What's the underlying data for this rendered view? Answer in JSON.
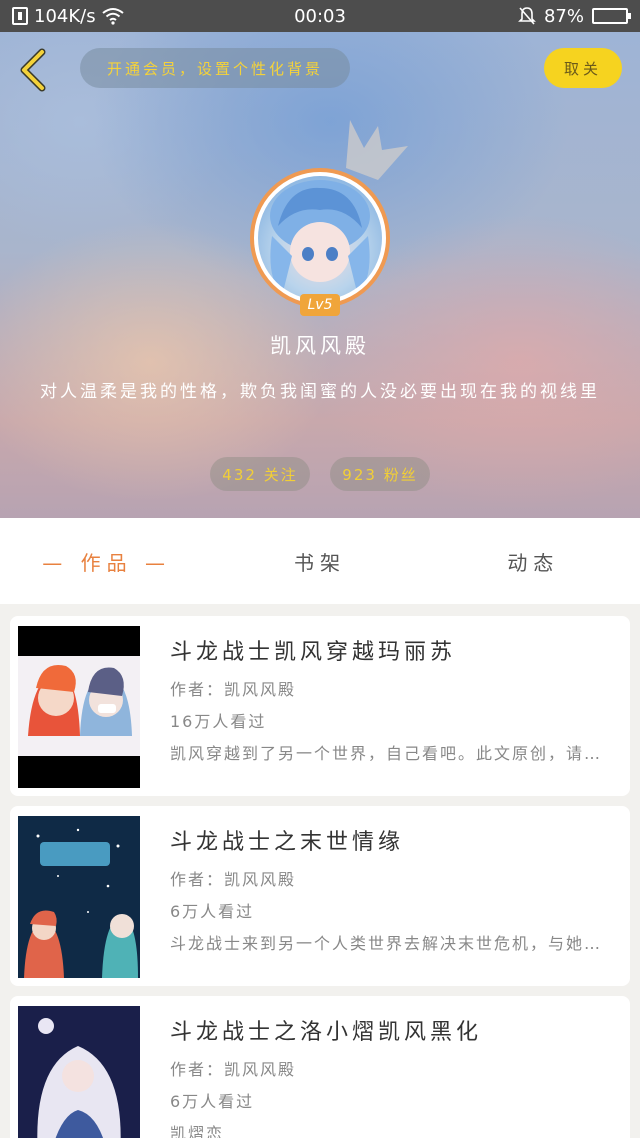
{
  "status_bar": {
    "network_speed": "104K/s",
    "time": "00:03",
    "battery": "87%",
    "battery_level": 0.87
  },
  "header": {
    "vip_prompt": "开通会员，设置个性化背景",
    "cancel_label": "取关",
    "level": "Lv5",
    "username": "凯风风殿",
    "bio": "对人温柔是我的性格，欺负我闺蜜的人没必要出现在我的视线里",
    "following": "432 关注",
    "followers": "923 粉丝"
  },
  "tabs": [
    {
      "label": "— 作品 —",
      "active": true
    },
    {
      "label": "书架",
      "active": false
    },
    {
      "label": "动态",
      "active": false
    }
  ],
  "works": [
    {
      "title": "斗龙战士凯风穿越玛丽苏",
      "author": "作者：凯风风殿",
      "views": "16万人看过",
      "summary": "凯风穿越到了另一个世界，自己看吧。此文原创，请勿抄袭"
    },
    {
      "title": "斗龙战士之末世情缘",
      "author": "作者：凯风风殿",
      "views": "6万人看过",
      "summary": "斗龙战士来到另一个人类世界去解决末世危机，与她们相遇"
    },
    {
      "title": "斗龙战士之洛小熠凯风黑化",
      "author": "作者：凯风风殿",
      "views": "6万人看过",
      "summary": "凯熠恋"
    }
  ],
  "colors": {
    "accent": "#e8813f",
    "gold": "#f6d31f",
    "stat_text": "#f2cf36"
  }
}
